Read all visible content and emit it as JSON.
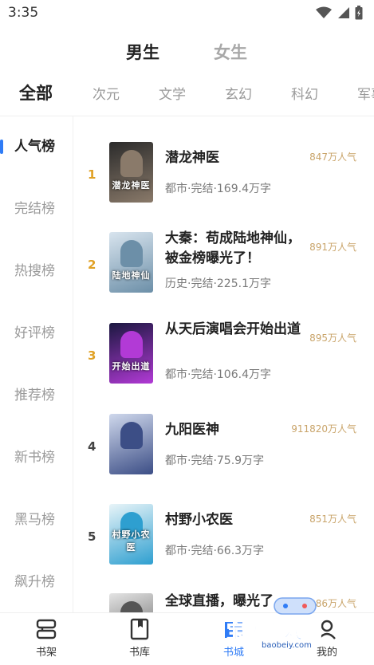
{
  "status_bar": {
    "time": "3:35",
    "icons": [
      "wifi-icon",
      "signal-icon",
      "battery-icon"
    ]
  },
  "gender_tabs": [
    {
      "label": "男生",
      "active": true
    },
    {
      "label": "女生",
      "active": false
    }
  ],
  "category_tabs": [
    {
      "label": "全部",
      "active": true
    },
    {
      "label": "次元"
    },
    {
      "label": "文学"
    },
    {
      "label": "玄幻"
    },
    {
      "label": "科幻"
    },
    {
      "label": "军事"
    }
  ],
  "sidebar": {
    "items": [
      {
        "label": "人气榜",
        "active": true
      },
      {
        "label": "完结榜"
      },
      {
        "label": "热搜榜"
      },
      {
        "label": "好评榜"
      },
      {
        "label": "推荐榜"
      },
      {
        "label": "新书榜"
      },
      {
        "label": "黑马榜"
      },
      {
        "label": "飙升榜"
      }
    ]
  },
  "books": [
    {
      "rank": "1",
      "title": "潜龙神医",
      "meta": "都市·完结·169.4万字",
      "popularity": "847万人气",
      "cover_text": "潜龙神医",
      "cover_colors": [
        "#2b2b2b",
        "#8a7a6a"
      ]
    },
    {
      "rank": "2",
      "title": "大秦：苟成陆地神仙，被金榜曝光了！",
      "meta": "历史·完结·225.1万字",
      "popularity": "891万人气",
      "cover_text": "陆地神仙",
      "cover_colors": [
        "#d8e4ee",
        "#6c8fa8"
      ]
    },
    {
      "rank": "3",
      "title": "从天后演唱会开始出道",
      "meta": "都市·完结·106.4万字",
      "popularity": "895万人气",
      "cover_text": "开始出道",
      "cover_colors": [
        "#1b1840",
        "#b23ad6"
      ]
    },
    {
      "rank": "4",
      "title": "九阳医神",
      "meta": "都市·完结·75.9万字",
      "popularity": "911820万人气",
      "cover_text": "",
      "cover_colors": [
        "#cfd8ec",
        "#3c4e86"
      ]
    },
    {
      "rank": "5",
      "title": "村野小农医",
      "meta": "都市·完结·66.3万字",
      "popularity": "851万人气",
      "cover_text": "村野小农医",
      "cover_colors": [
        "#e8f4f8",
        "#2e9fd0"
      ]
    },
    {
      "rank": "6",
      "title": "全球直播，曝光了",
      "meta": "",
      "popularity": "886万人气",
      "cover_text": "",
      "cover_colors": [
        "#e4e4e4",
        "#555555"
      ]
    }
  ],
  "bottom_nav": [
    {
      "label": "书架",
      "icon": "bookshelf-icon",
      "active": false
    },
    {
      "label": "书库",
      "icon": "library-icon",
      "active": false
    },
    {
      "label": "书城",
      "icon": "bookstore-icon",
      "active": true
    },
    {
      "label": "我的",
      "icon": "profile-icon",
      "active": false
    }
  ],
  "watermark": {
    "text": "宝贝游戏网",
    "sub": "baobeiy.com"
  },
  "colors": {
    "accent": "#2f7cf6",
    "rank_top": "#e0a125",
    "popularity": "#c9a46a"
  }
}
